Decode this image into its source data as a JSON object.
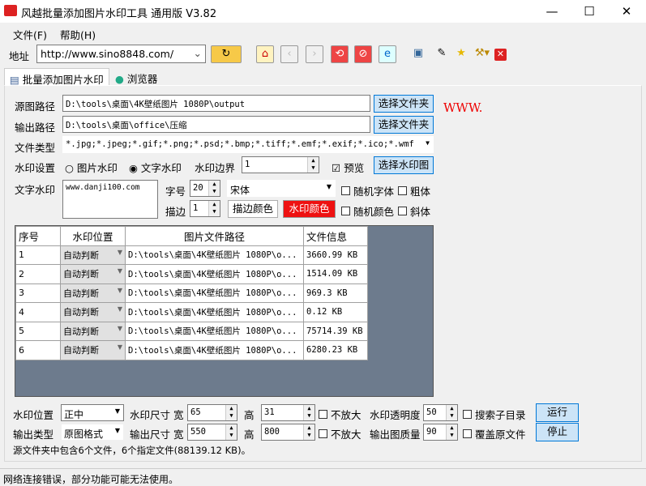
{
  "window": {
    "title": "风越批量添加图片水印工具 通用版 V3.82",
    "minimize": "—",
    "maximize": "☐",
    "close": "✕"
  },
  "menu": [
    "文件(F)",
    "帮助(H)"
  ],
  "toolbar": {
    "address_label": "地址",
    "address_value": "http://www.sino8848.com/",
    "icons": [
      "go-icon",
      "refresh-icon",
      "home-icon",
      "back-icon",
      "forward-icon",
      "reload-icon",
      "stop-icon",
      "ie-icon",
      "save-icon",
      "tools-icon",
      "favorites-star-icon",
      "hammer-icon",
      "close-red-icon"
    ]
  },
  "tabs": [
    "批量添加图片水印",
    "浏览器"
  ],
  "form": {
    "source_label": "源图路径",
    "source_value": "D:\\tools\\桌面\\4K壁纸图片 1080P\\output",
    "select_folder": "选择文件夹",
    "output_label": "输出路径",
    "output_value": "D:\\tools\\桌面\\office\\压缩",
    "filetype_label": "文件类型",
    "filetype_value": "*.jpg;*.jpeg;*.gif;*.png;*.psd;*.bmp;*.tiff;*.emf;*.exif;*.ico;*.wmf",
    "wm_setting_label": "水印设置",
    "radio_image": "图片水印",
    "radio_text": "文字水印",
    "border_label": "水印边界",
    "border_value": "1",
    "preview_label": "预览",
    "select_wm_image": "选择水印图",
    "text_wm_label": "文字水印",
    "text_wm_value": "www.danji100.com",
    "fontsize_label": "字号",
    "fontsize_value": "20",
    "font_value": "宋体",
    "random_font": "随机字体",
    "bold": "粗体",
    "stroke_label": "描边",
    "stroke_value": "1",
    "stroke_color_btn": "描边颜色",
    "wm_color_btn": "水印颜色",
    "random_color": "随机颜色",
    "italic": "斜体",
    "preview_text": "WWW."
  },
  "table": {
    "headers": [
      "序号",
      "水印位置",
      "图片文件路径",
      "文件信息"
    ],
    "rows": [
      [
        "1",
        "自动判断",
        "D:\\tools\\桌面\\4K壁纸图片 1080P\\o...",
        "3660.99 KB"
      ],
      [
        "2",
        "自动判断",
        "D:\\tools\\桌面\\4K壁纸图片 1080P\\o...",
        "1514.09 KB"
      ],
      [
        "3",
        "自动判断",
        "D:\\tools\\桌面\\4K壁纸图片 1080P\\o...",
        "969.3 KB"
      ],
      [
        "4",
        "自动判断",
        "D:\\tools\\桌面\\4K壁纸图片 1080P\\o...",
        "0.12 KB"
      ],
      [
        "5",
        "自动判断",
        "D:\\tools\\桌面\\4K壁纸图片 1080P\\o...",
        "75714.39 KB"
      ],
      [
        "6",
        "自动判断",
        "D:\\tools\\桌面\\4K壁纸图片 1080P\\o...",
        "6280.23 KB"
      ]
    ]
  },
  "bottom": {
    "pos_label": "水印位置",
    "pos_value": "正中",
    "wm_size_label": "水印尺寸",
    "width_label": "宽",
    "wm_w": "65",
    "height_label": "高",
    "wm_h": "31",
    "no_enlarge": "不放大",
    "opacity_label": "水印透明度",
    "opacity": "50",
    "search_sub": "搜索子目录",
    "run": "运行",
    "out_type_label": "输出类型",
    "out_type_value": "原图格式",
    "out_size_label": "输出尺寸",
    "out_w": "550",
    "out_h": "800",
    "quality_label": "输出图质量",
    "quality": "90",
    "overwrite": "覆盖原文件",
    "stop": "停止",
    "summary": "源文件夹中包含6个文件，6个指定文件(88139.12 KB)。"
  },
  "status": "网络连接错误，部分功能可能无法使用。",
  "colors": {
    "wm_color": "#ff0000",
    "grid_bg": "#6d7b8d",
    "button_blue": "#cce4f7"
  }
}
